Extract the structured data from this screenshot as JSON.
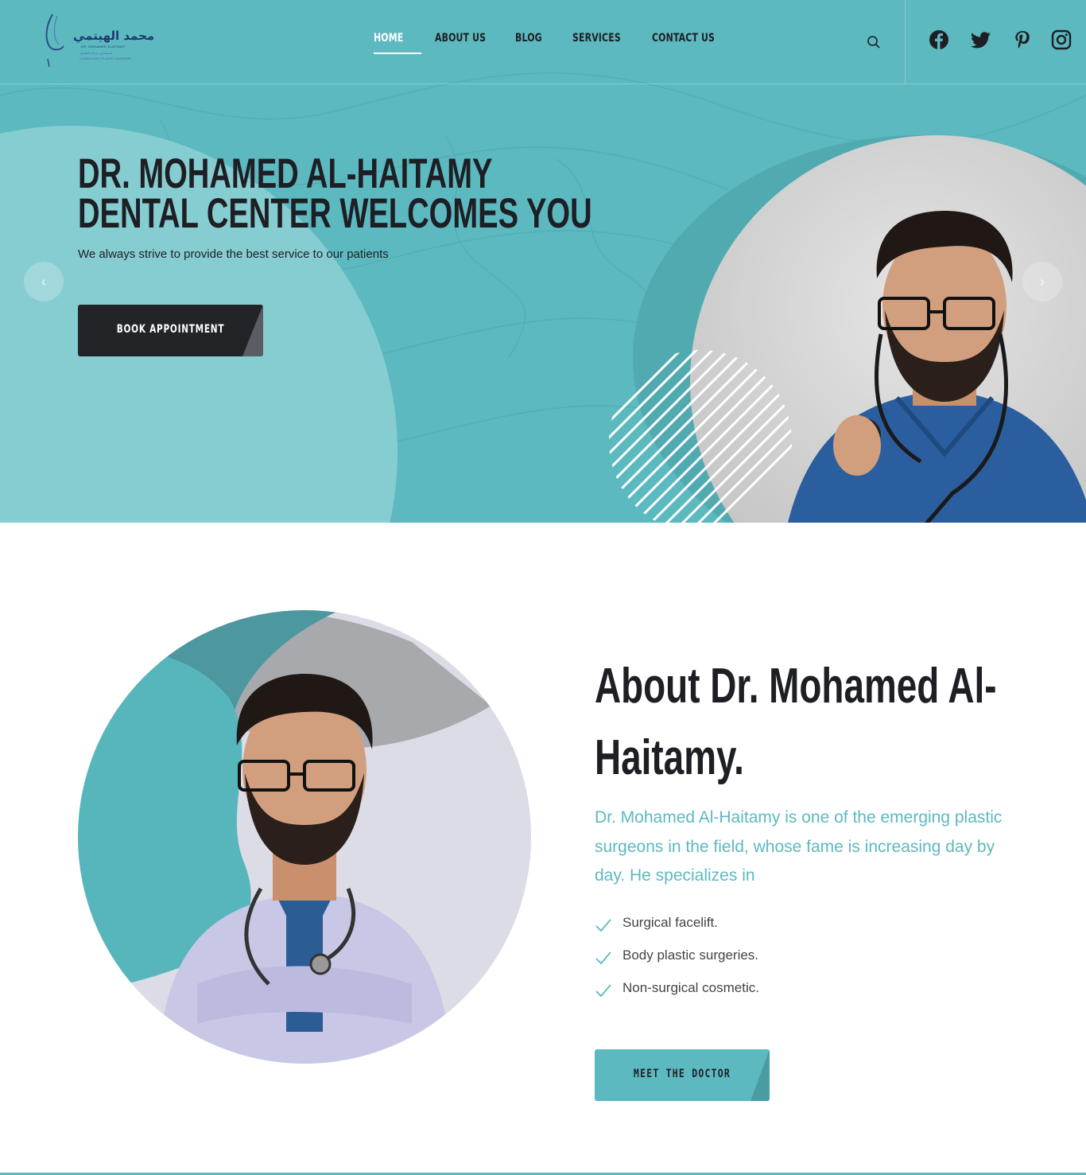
{
  "brand": {
    "logo_ar": "محمد الهيتمي",
    "logo_en": "DR. MOHAMED ELHITAMY",
    "logo_tagline": "استشاري جراحة التجميل",
    "logo_tagline2": "CONSULTANT PLASTIC SURGERY",
    "accent": "#5cb9c0",
    "dark": "#1e1f24"
  },
  "nav": {
    "items": [
      {
        "label": "HOME",
        "active": true
      },
      {
        "label": "ABOUT US",
        "active": false
      },
      {
        "label": "BLOG",
        "active": false
      },
      {
        "label": "SERVICES",
        "active": false
      },
      {
        "label": "CONTACT US",
        "active": false
      }
    ]
  },
  "header": {
    "search_icon": "search-icon",
    "social": [
      "facebook-icon",
      "twitter-icon",
      "pinterest-icon",
      "instagram-icon"
    ]
  },
  "hero": {
    "title_line1": "DR. MOHAMED AL-HAITAMY",
    "title_line2": "DENTAL CENTER WELCOMES YOU",
    "subtitle": "We always strive to provide the best service to our patients",
    "cta": "BOOK APPOINTMENT",
    "prev_arrow": "‹",
    "next_arrow": "›"
  },
  "about": {
    "title_line1": "About Dr. Mohamed Al-",
    "title_line2": "Haitamy.",
    "description": "Dr. Mohamed Al-Haitamy is one of the emerging plastic surgeons in the field, whose fame is increasing day by day. He specializes in",
    "features": [
      "Surgical facelift.",
      "Body plastic surgeries.",
      "Non-surgical cosmetic."
    ],
    "cta": "MEET THE DOCTOR"
  }
}
